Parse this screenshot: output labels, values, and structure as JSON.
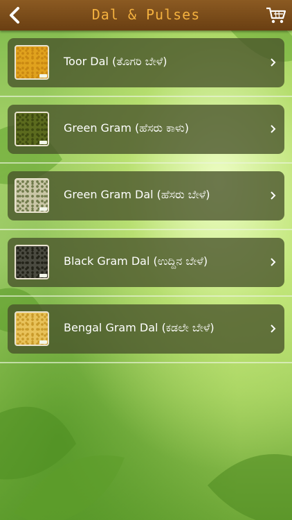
{
  "header": {
    "title": "Dal & Pulses",
    "back_icon": "back-arrow-icon",
    "cart_icon": "shopping-cart-icon"
  },
  "items": [
    {
      "label": "Toor Dal (ತೊಗರಿ ಬೇಳೆ)",
      "thumb_color": "#e0a21e",
      "texture": "#c98812"
    },
    {
      "label": "Green Gram (ಹೆಸರು ಕಾಳು)",
      "thumb_color": "#5b6a1e",
      "texture": "#3e4a10"
    },
    {
      "label": "Green Gram Dal (ಹೆಸರು ಬೇಳೆ)",
      "thumb_color": "#c9c6a6",
      "texture": "#6f7a4a"
    },
    {
      "label": "Black Gram Dal (ಉದ್ದಿನ ಬೇಳೆ)",
      "thumb_color": "#4a4a40",
      "texture": "#222218"
    },
    {
      "label": "Bengal Gram Dal (ಕಡಲೇ ಬೇಳೆ)",
      "thumb_color": "#e8c25a",
      "texture": "#c99a2a"
    }
  ]
}
